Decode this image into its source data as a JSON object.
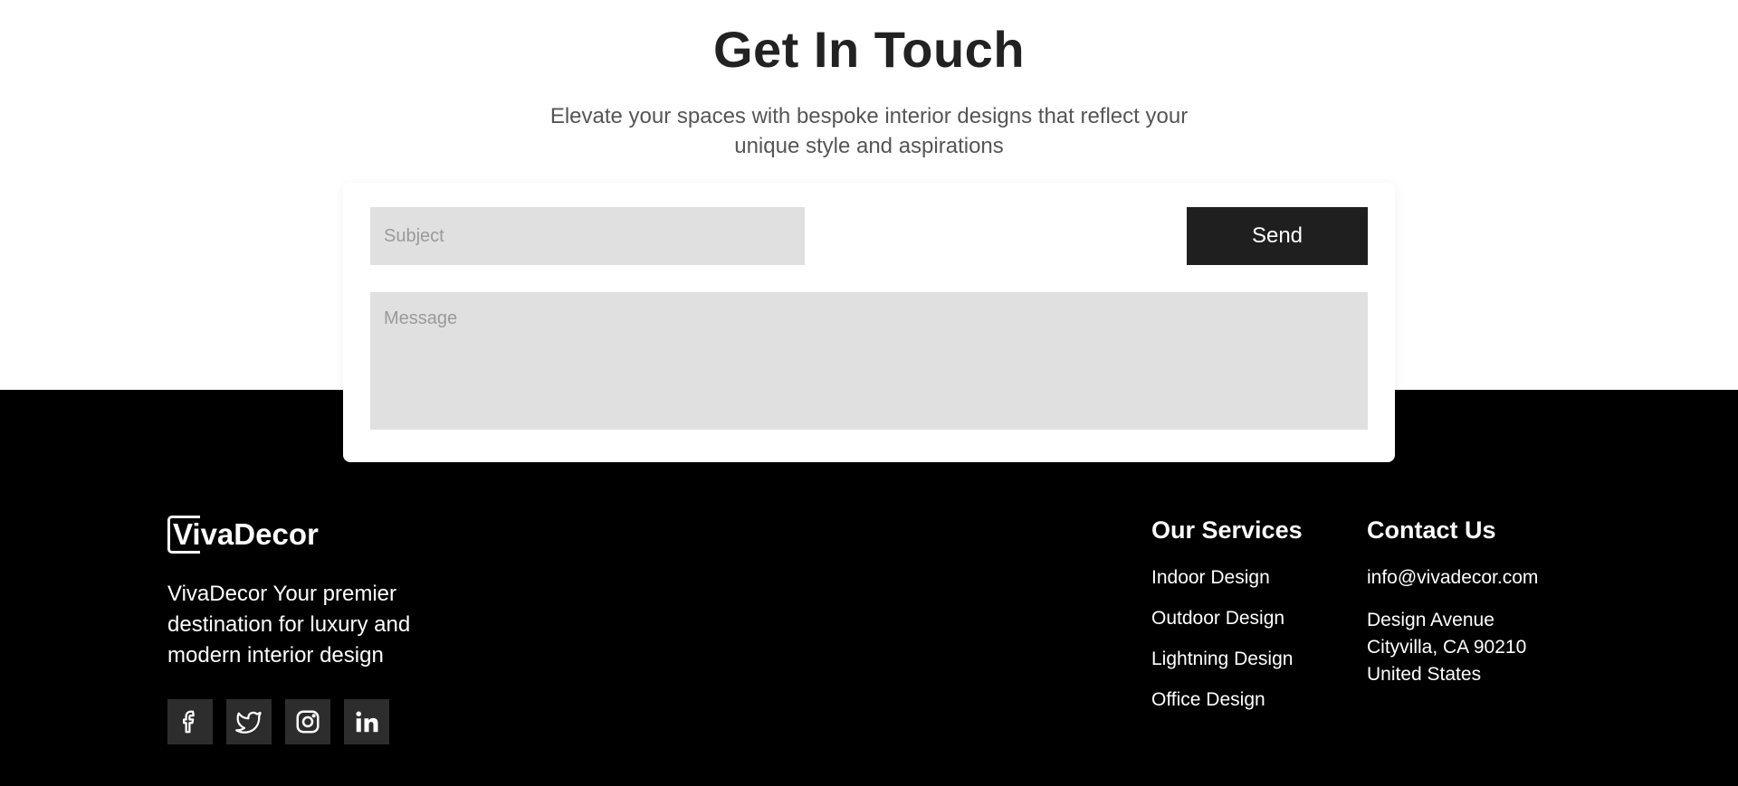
{
  "contact": {
    "heading": "Get In Touch",
    "subtitle": "Elevate your spaces with bespoke interior designs that reflect your unique style and aspirations",
    "subject_placeholder": "Subject",
    "message_placeholder": "Message",
    "send_label": "Send"
  },
  "footer": {
    "logo_text": "VivaDecor",
    "tagline": "VivaDecor Your premier destination for luxury and modern interior design",
    "socials": [
      "facebook-icon",
      "twitter-icon",
      "instagram-icon",
      "linkedin-icon"
    ],
    "services": {
      "title": "Our Services",
      "items": [
        "Indoor Design",
        "Outdoor Design",
        "Lightning Design",
        "Office Design"
      ]
    },
    "contact": {
      "title": "Contact Us",
      "email": "info@vivadecor.com",
      "address": [
        "Design Avenue",
        "Cityvilla, CA 90210",
        "United States"
      ]
    }
  },
  "colors": {
    "footer_bg": "#000000",
    "button_bg": "#1f1f1f",
    "input_bg": "#e0e0e0",
    "social_bg": "#2d2d2d"
  }
}
